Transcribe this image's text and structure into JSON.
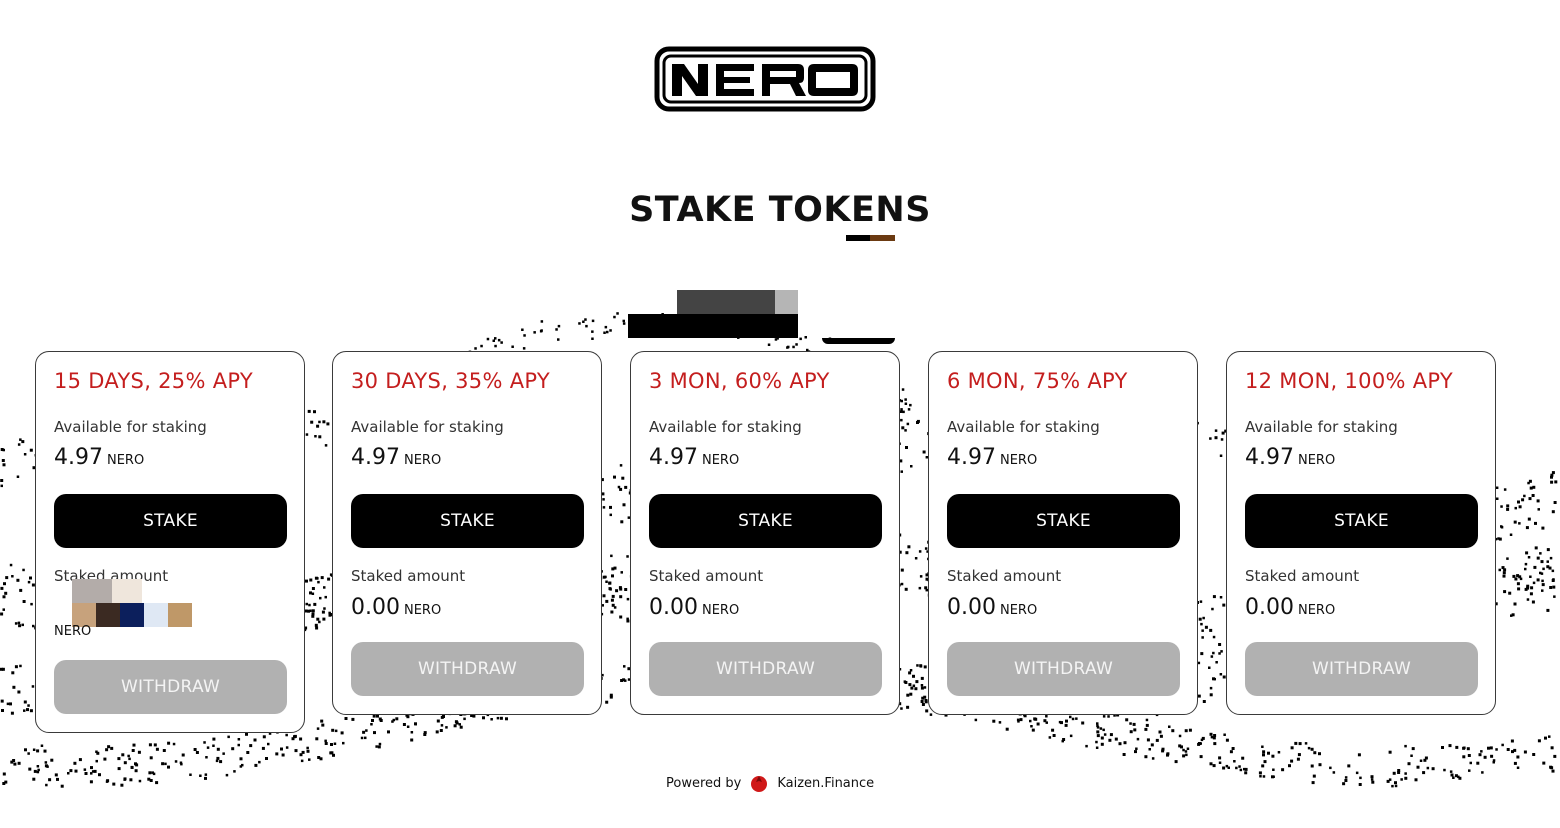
{
  "header": {
    "logo_text": "NERO",
    "title": "STAKE TOKENS"
  },
  "colors": {
    "accent_red": "#c41e1e",
    "stake_button": "#000000",
    "withdraw_button": "#b1b1b1"
  },
  "cards": [
    {
      "heading": "15 DAYS, 25% APY",
      "available_label": "Available for staking",
      "available_value": "4.97",
      "available_unit": "NERO",
      "stake_label": "STAKE",
      "staked_label": "Staked amount",
      "staked_unit": "NERO",
      "withdraw_label": "WITHDRAW"
    },
    {
      "heading": "30 DAYS, 35% APY",
      "available_label": "Available for staking",
      "available_value": "4.97",
      "available_unit": "NERO",
      "stake_label": "STAKE",
      "staked_label": "Staked amount",
      "staked_value": "0.00",
      "staked_unit": "NERO",
      "withdraw_label": "WITHDRAW"
    },
    {
      "heading": "3 MON, 60% APY",
      "available_label": "Available for staking",
      "available_value": "4.97",
      "available_unit": "NERO",
      "stake_label": "STAKE",
      "staked_label": "Staked amount",
      "staked_value": "0.00",
      "staked_unit": "NERO",
      "withdraw_label": "WITHDRAW"
    },
    {
      "heading": "6 MON, 75% APY",
      "available_label": "Available for staking",
      "available_value": "4.97",
      "available_unit": "NERO",
      "stake_label": "STAKE",
      "staked_label": "Staked amount",
      "staked_value": "0.00",
      "staked_unit": "NERO",
      "withdraw_label": "WITHDRAW"
    },
    {
      "heading": "12 MON, 100% APY",
      "available_label": "Available for staking",
      "available_value": "4.97",
      "available_unit": "NERO",
      "stake_label": "STAKE",
      "staked_label": "Staked amount",
      "staked_value": "0.00",
      "staked_unit": "NERO",
      "withdraw_label": "WITHDRAW"
    }
  ],
  "footer": {
    "powered_by": "Powered by",
    "brand": "Kaizen.Finance",
    "brand_icon": "kaizen-logo-icon"
  }
}
